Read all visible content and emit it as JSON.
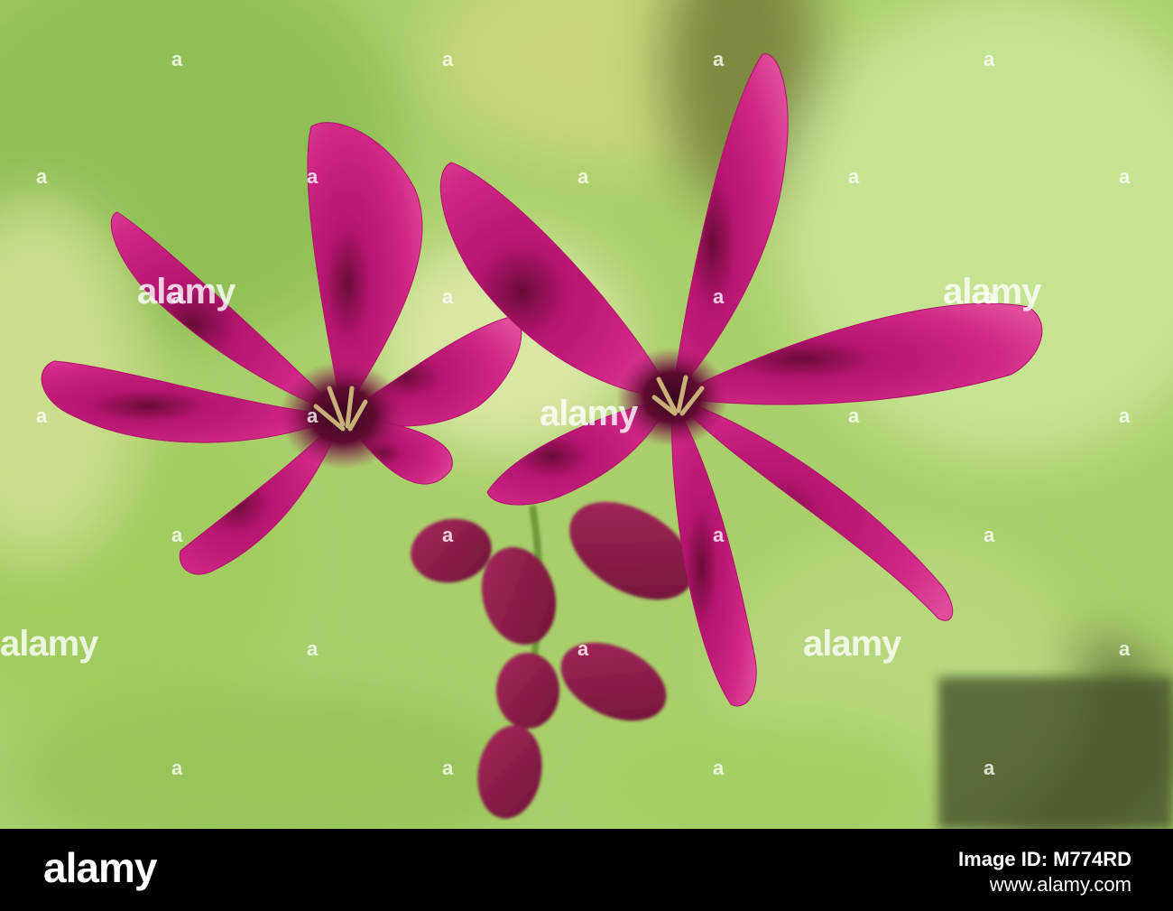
{
  "photo": {
    "subject_icon": "pink-flower-photo",
    "colors": {
      "background": "#a9cf6a",
      "petal": "#c4177c",
      "petal_light": "#e0509e",
      "center": "#5a0b2e",
      "bud": "#8e1c4a"
    },
    "watermark_text": "alamy",
    "watermark_mark": "a"
  },
  "footer": {
    "logo": "alamy",
    "caption": "Image ID: M774RD",
    "site": "www.alamy.com"
  }
}
